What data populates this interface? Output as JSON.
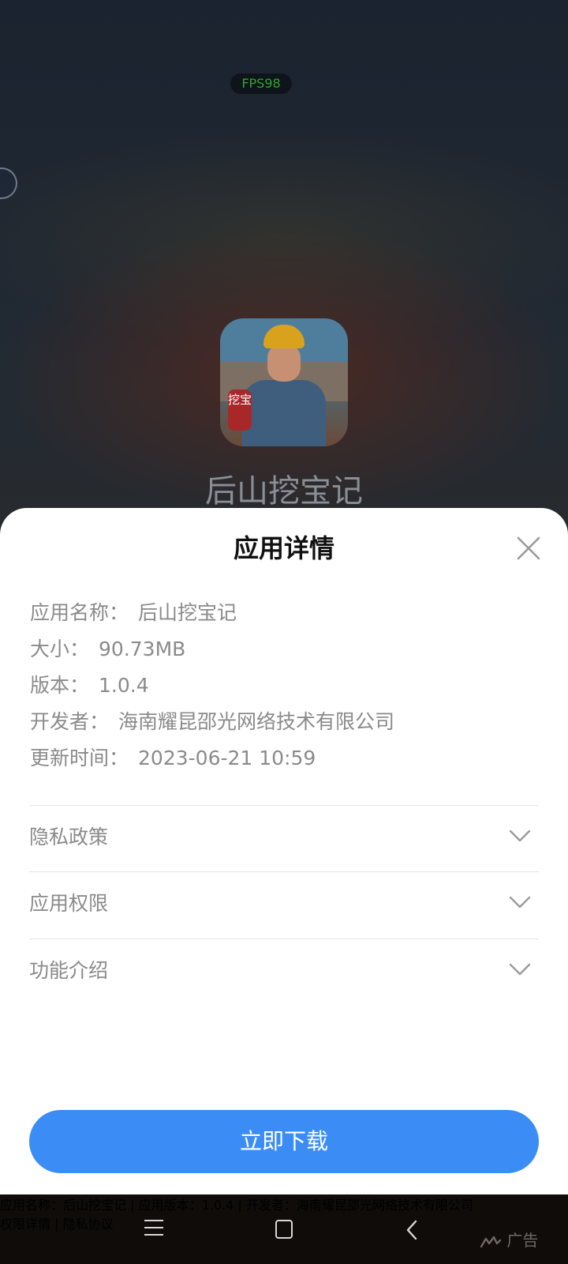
{
  "overlay": {
    "fps": "FPS98",
    "app_title": "后山挖宝记",
    "icon_tag": "挖宝"
  },
  "sheet": {
    "title": "应用详情",
    "details": [
      {
        "key": "应用名称：",
        "value": "后山挖宝记"
      },
      {
        "key": "大小：",
        "value": "90.73MB"
      },
      {
        "key": "版本：",
        "value": "1.0.4"
      },
      {
        "key": "开发者：",
        "value": "海南耀昆邵光网络技术有限公司"
      },
      {
        "key": "更新时间：",
        "value": "2023-06-21 10:59"
      }
    ],
    "sections": [
      {
        "label": "隐私政策"
      },
      {
        "label": "应用权限"
      },
      {
        "label": "功能介绍"
      }
    ],
    "download_label": "立即下载"
  },
  "footer": {
    "line1": "应用名称：后山挖宝记 | 应用版本：1.0.4 | 开发者：海南耀昆邵光网络技术有限公司",
    "permissions_link": "权限详情",
    "separator": " | ",
    "privacy_link": "隐私协议",
    "ad_label": "广告"
  },
  "colors": {
    "accent": "#3b8df5",
    "fps_text": "#2fa52f"
  }
}
